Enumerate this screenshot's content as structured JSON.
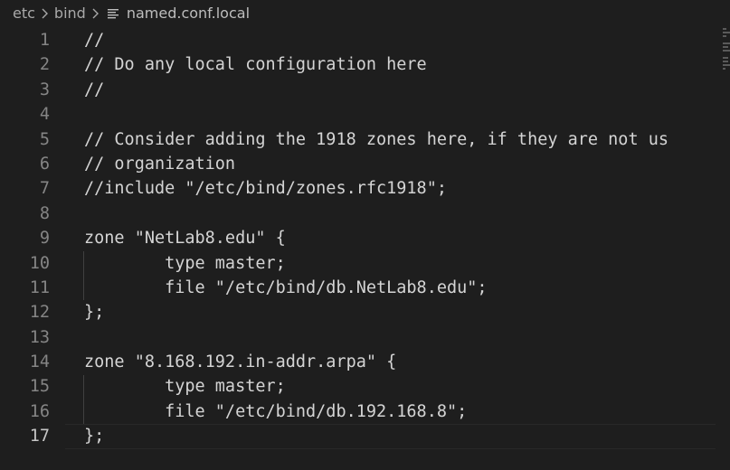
{
  "breadcrumb": {
    "items": [
      "etc",
      "bind"
    ],
    "file": "named.conf.local",
    "file_icon": "lines-file-icon"
  },
  "editor": {
    "active_line": 17,
    "lines": [
      {
        "n": "1",
        "text": "//"
      },
      {
        "n": "2",
        "text": "// Do any local configuration here"
      },
      {
        "n": "3",
        "text": "//"
      },
      {
        "n": "4",
        "text": ""
      },
      {
        "n": "5",
        "text": "// Consider adding the 1918 zones here, if they are not us"
      },
      {
        "n": "6",
        "text": "// organization"
      },
      {
        "n": "7",
        "text": "//include \"/etc/bind/zones.rfc1918\";"
      },
      {
        "n": "8",
        "text": ""
      },
      {
        "n": "9",
        "text": "zone \"NetLab8.edu\" {"
      },
      {
        "n": "10",
        "text": "        type master;"
      },
      {
        "n": "11",
        "text": "        file \"/etc/bind/db.NetLab8.edu\";"
      },
      {
        "n": "12",
        "text": "};"
      },
      {
        "n": "13",
        "text": ""
      },
      {
        "n": "14",
        "text": "zone \"8.168.192.in-addr.arpa\" {"
      },
      {
        "n": "15",
        "text": "        type master;"
      },
      {
        "n": "16",
        "text": "        file \"/etc/bind/db.192.168.8\";"
      },
      {
        "n": "17",
        "text": "};"
      }
    ]
  }
}
